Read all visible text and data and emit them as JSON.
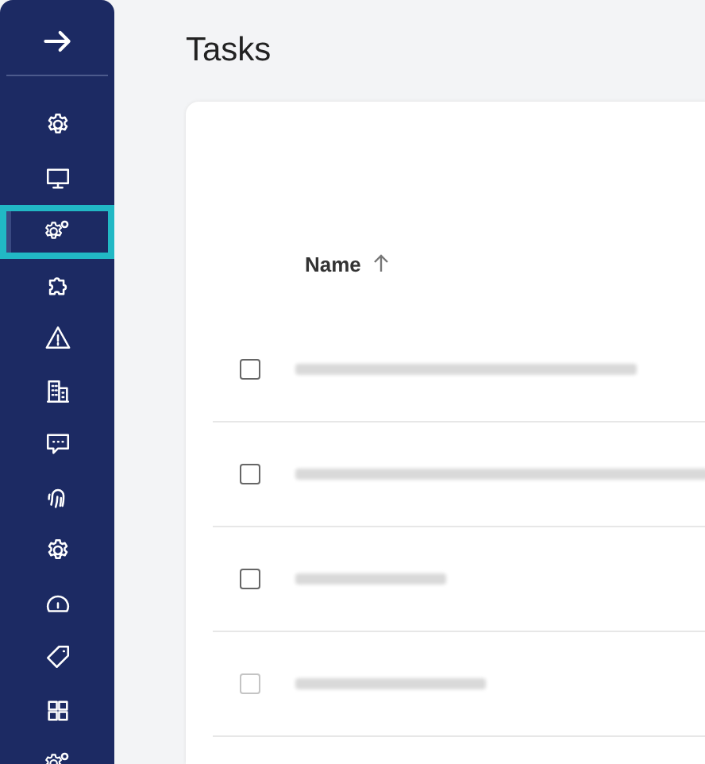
{
  "sidebar": {
    "items": [
      {
        "kind": "gear",
        "selected": false
      },
      {
        "kind": "monitor",
        "selected": false
      },
      {
        "kind": "gears",
        "selected": true
      },
      {
        "kind": "puzzle",
        "selected": false
      },
      {
        "kind": "warning",
        "selected": false
      },
      {
        "kind": "building",
        "selected": false
      },
      {
        "kind": "chat",
        "selected": false
      },
      {
        "kind": "fingerprint",
        "selected": false
      },
      {
        "kind": "gear",
        "selected": false
      },
      {
        "kind": "gauge",
        "selected": false
      },
      {
        "kind": "tag",
        "selected": false
      },
      {
        "kind": "grid",
        "selected": false
      },
      {
        "kind": "gears",
        "selected": false
      }
    ]
  },
  "page": {
    "title": "Tasks"
  },
  "table": {
    "columns": [
      {
        "label": "Name",
        "sorted_ascending": true
      }
    ],
    "rows": [
      {
        "checked": false,
        "disabled": false
      },
      {
        "checked": false,
        "disabled": false
      },
      {
        "checked": false,
        "disabled": false
      },
      {
        "checked": false,
        "disabled": true
      }
    ]
  }
}
